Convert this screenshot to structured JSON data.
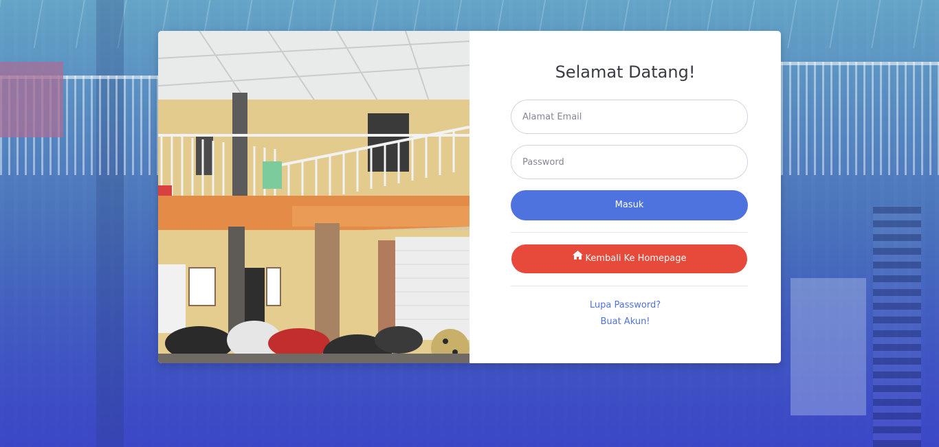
{
  "login": {
    "title": "Selamat Datang!",
    "email_placeholder": "Alamat Email",
    "password_placeholder": "Password",
    "submit_label": "Masuk",
    "home_label": "Kembali Ke Homepage",
    "forgot_label": "Lupa Password?",
    "register_label": "Buat Akun!"
  },
  "colors": {
    "primary": "#4e73df",
    "danger": "#e74a3b",
    "text": "#3a3b45"
  },
  "icons": {
    "home": "home-icon"
  }
}
